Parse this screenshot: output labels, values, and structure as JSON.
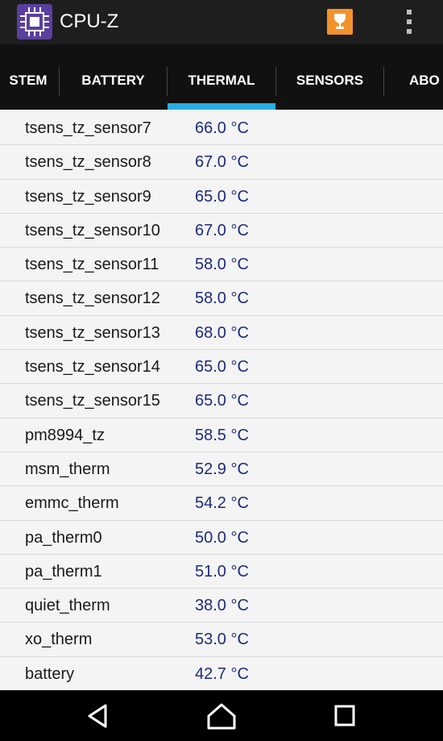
{
  "app": {
    "title": "CPU-Z"
  },
  "tabs": [
    {
      "label": "STEM"
    },
    {
      "label": "BATTERY"
    },
    {
      "label": "THERMAL"
    },
    {
      "label": "SENSORS"
    },
    {
      "label": "ABO"
    }
  ],
  "active_tab": "THERMAL",
  "rows": [
    {
      "name": "tsens_tz_sensor7",
      "value": "66.0 °C"
    },
    {
      "name": "tsens_tz_sensor8",
      "value": "67.0 °C"
    },
    {
      "name": "tsens_tz_sensor9",
      "value": "65.0 °C"
    },
    {
      "name": "tsens_tz_sensor10",
      "value": "67.0 °C"
    },
    {
      "name": "tsens_tz_sensor11",
      "value": "58.0 °C"
    },
    {
      "name": "tsens_tz_sensor12",
      "value": "58.0 °C"
    },
    {
      "name": "tsens_tz_sensor13",
      "value": "68.0 °C"
    },
    {
      "name": "tsens_tz_sensor14",
      "value": "65.0 °C"
    },
    {
      "name": "tsens_tz_sensor15",
      "value": "65.0 °C"
    },
    {
      "name": "pm8994_tz",
      "value": "58.5 °C"
    },
    {
      "name": "msm_therm",
      "value": "52.9 °C"
    },
    {
      "name": "emmc_therm",
      "value": "54.2 °C"
    },
    {
      "name": "pa_therm0",
      "value": "50.0 °C"
    },
    {
      "name": "pa_therm1",
      "value": "51.0 °C"
    },
    {
      "name": "quiet_therm",
      "value": "38.0 °C"
    },
    {
      "name": "xo_therm",
      "value": "53.0 °C"
    },
    {
      "name": "battery",
      "value": "42.7 °C"
    }
  ],
  "colors": {
    "accent": "#2aaee4",
    "appbar": "#1e1e1e",
    "tabbar": "#111111",
    "value_text": "#1d2b7a"
  },
  "icons": {
    "app": "cpu-chip-icon",
    "trophy": "trophy-icon",
    "menu": "overflow-menu-icon",
    "back": "back-icon",
    "home": "home-icon",
    "recents": "recents-icon"
  }
}
